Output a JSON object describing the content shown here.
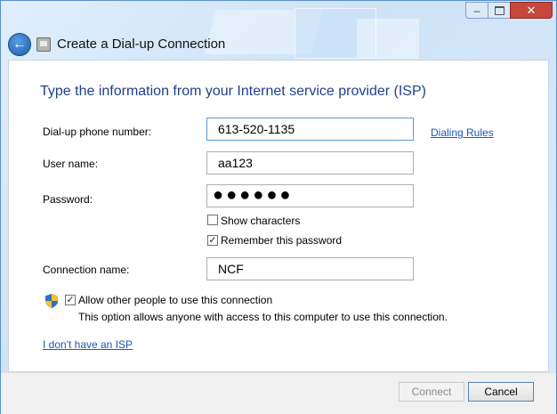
{
  "window": {
    "title": "Create a Dial-up Connection",
    "minimize_glyph": "–",
    "close_glyph": "✕"
  },
  "heading": "Type the information from your Internet service provider (ISP)",
  "form": {
    "phone_label": "Dial-up phone number:",
    "phone_value": "613-520-1135",
    "dialing_rules_link": "Dialing Rules",
    "username_label": "User name:",
    "username_value": "aa123",
    "password_label": "Password:",
    "password_mask": "●●●●●●",
    "show_characters_label": "Show characters",
    "show_characters_checked": false,
    "remember_password_label": "Remember this password",
    "remember_password_checked": true,
    "connection_name_label": "Connection name:",
    "connection_name_value": "NCF",
    "allow_others_label": "Allow other people to use this connection",
    "allow_others_checked": true,
    "allow_others_note": "This option allows anyone with access to this computer to use this connection.",
    "no_isp_link": "I don't have an ISP"
  },
  "buttons": {
    "connect": "Connect",
    "cancel": "Cancel"
  },
  "icons": {
    "back": "back-arrow-icon",
    "app": "dialup-modem-icon",
    "uac": "uac-shield-icon"
  },
  "colors": {
    "heading": "#1e3f8f",
    "link": "#1d57b8",
    "close_button": "#c7473d"
  }
}
